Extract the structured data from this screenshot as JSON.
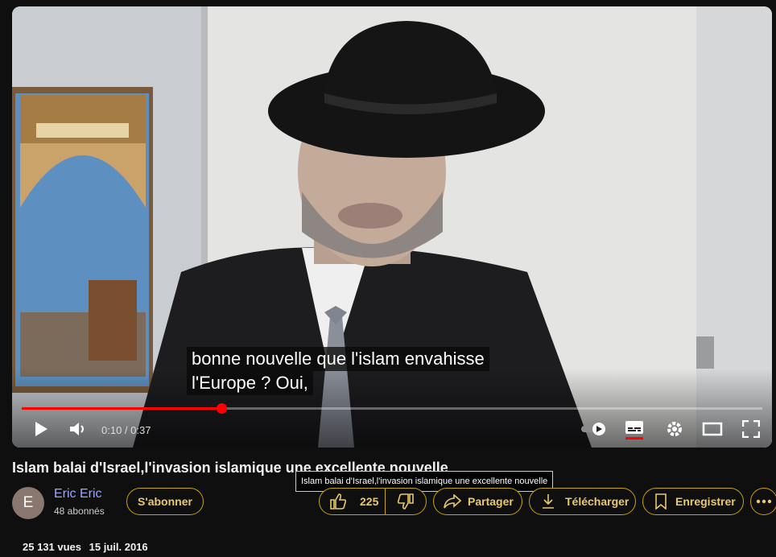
{
  "player": {
    "subtitle_line1": "bonne nouvelle que l'islam envahisse",
    "subtitle_line2": "l'Europe ? Oui,",
    "time_display": "0:10 / 0:37",
    "progress_fraction": 0.27,
    "accent_color": "#ff0000",
    "icons": [
      "play-icon",
      "volume-icon",
      "autoplay-toggle",
      "subtitles-icon",
      "settings-icon",
      "theater-icon",
      "fullscreen-icon"
    ]
  },
  "video": {
    "title": "Islam balai d'Israel,l'invasion islamique une excellente nouvelle",
    "tooltip": "Islam balai d'Israel,l'invasion islamique une excellente nouvelle"
  },
  "channel": {
    "avatar_letter": "E",
    "name": "Eric Eric",
    "subscribers": "48 abonnés",
    "subscribe_label": "S'abonner"
  },
  "actions": {
    "like_count": "225",
    "share_label": "Partager",
    "download_label": "Télécharger",
    "save_label": "Enregistrer"
  },
  "stats": {
    "views": "25 131 vues",
    "date": "15 juil. 2016"
  }
}
